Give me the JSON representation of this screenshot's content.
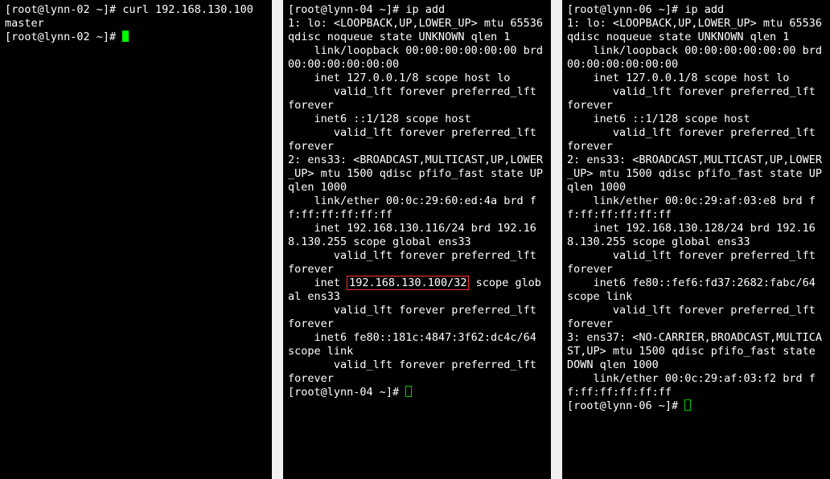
{
  "pane1": {
    "prompt1_pre": "[root@lynn-02 ~]# ",
    "cmd1": "curl 192.168.130.100",
    "out1": "master",
    "prompt2_pre": "[root@lynn-02 ~]# "
  },
  "pane2": {
    "prompt1_pre": "[root@lynn-04 ~]# ",
    "cmd1": "ip add",
    "l0": "1: lo: <LOOPBACK,UP,LOWER_UP> mtu 65536 qdisc noqueue state UNKNOWN qlen 1",
    "l1": "    link/loopback 00:00:00:00:00:00 brd 00:00:00:00:00:00",
    "l2": "    inet 127.0.0.1/8 scope host lo",
    "l3": "       valid_lft forever preferred_lft forever",
    "l4": "    inet6 ::1/128 scope host",
    "l5": "       valid_lft forever preferred_lft forever",
    "l6": "2: ens33: <BROADCAST,MULTICAST,UP,LOWER_UP> mtu 1500 qdisc pfifo_fast state UP qlen 1000",
    "l7": "    link/ether 00:0c:29:60:ed:4a brd ff:ff:ff:ff:ff:ff",
    "l8": "    inet 192.168.130.116/24 brd 192.168.130.255 scope global ens33",
    "l9": "       valid_lft forever preferred_lft forever",
    "l10a": "    inet ",
    "l10box": "192.168.130.100/32",
    "l10b": " scope global ens33",
    "l11": "       valid_lft forever preferred_lft forever",
    "l12": "    inet6 fe80::181c:4847:3f62:dc4c/64 scope link",
    "l13": "       valid_lft forever preferred_lft forever",
    "prompt2_pre": "[root@lynn-04 ~]# "
  },
  "pane3": {
    "prompt1_pre": "[root@lynn-06 ~]# ",
    "cmd1": "ip add",
    "l0": "1: lo: <LOOPBACK,UP,LOWER_UP> mtu 65536 qdisc noqueue state UNKNOWN qlen 1",
    "l1": "    link/loopback 00:00:00:00:00:00 brd 00:00:00:00:00:00",
    "l2": "    inet 127.0.0.1/8 scope host lo",
    "l3": "       valid_lft forever preferred_lft forever",
    "l4": "    inet6 ::1/128 scope host",
    "l5": "       valid_lft forever preferred_lft forever",
    "l6": "2: ens33: <BROADCAST,MULTICAST,UP,LOWER_UP> mtu 1500 qdisc pfifo_fast state UP qlen 1000",
    "l7": "    link/ether 00:0c:29:af:03:e8 brd ff:ff:ff:ff:ff:ff",
    "l8": "    inet 192.168.130.128/24 brd 192.168.130.255 scope global ens33",
    "l9": "       valid_lft forever preferred_lft forever",
    "l10": "    inet6 fe80::fef6:fd37:2682:fabc/64 scope link",
    "l11": "       valid_lft forever preferred_lft forever",
    "l12": "3: ens37: <NO-CARRIER,BROADCAST,MULTICAST,UP> mtu 1500 qdisc pfifo_fast state DOWN qlen 1000",
    "l13": "    link/ether 00:0c:29:af:03:f2 brd ff:ff:ff:ff:ff:ff",
    "prompt2_pre": "[root@lynn-06 ~]# "
  }
}
